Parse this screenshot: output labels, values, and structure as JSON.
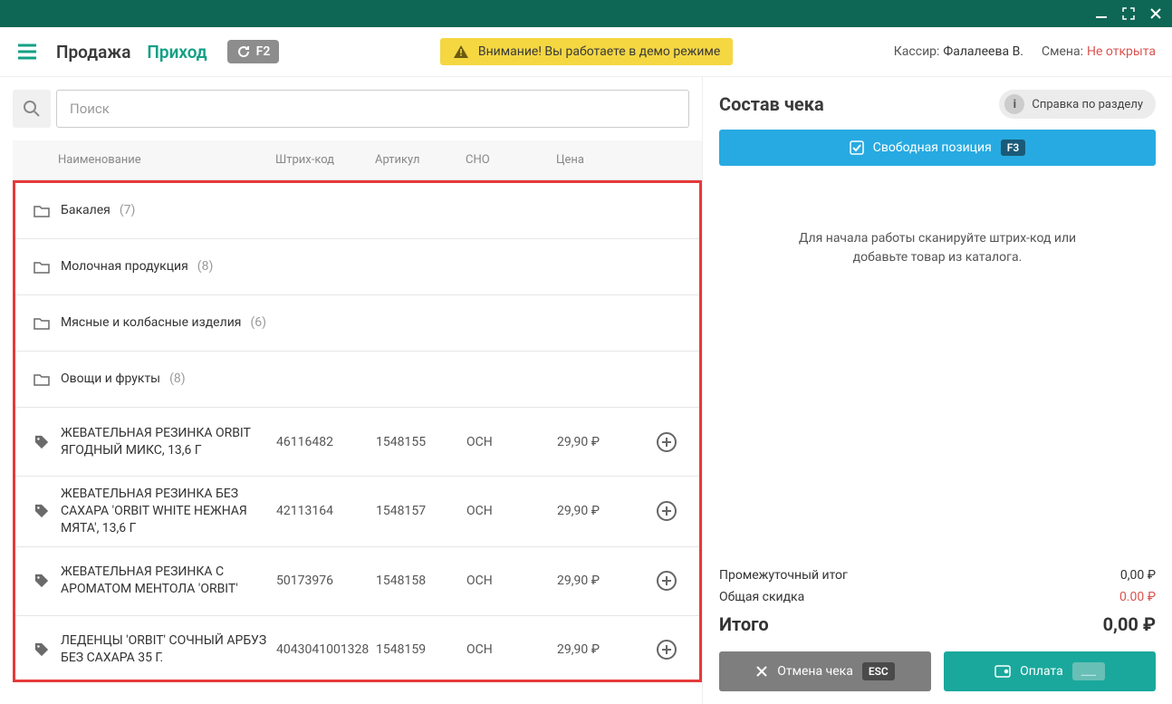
{
  "titlebar": {},
  "topbar": {
    "tab_sale": "Продажа",
    "tab_income": "Приход",
    "f2_key": "F2",
    "warning": "Внимание! Вы работаете в демо режиме",
    "cashier_label": "Кассир:",
    "cashier_name": "Фалалеева В.",
    "shift_label": "Смена:",
    "shift_value": "Не открыта"
  },
  "search": {
    "placeholder": "Поиск"
  },
  "columns": {
    "name": "Наименование",
    "barcode": "Штрих-код",
    "article": "Артикул",
    "sno": "СНО",
    "price": "Цена"
  },
  "folders": [
    {
      "name": "Бакалея",
      "count": "(7)"
    },
    {
      "name": "Молочная продукция",
      "count": "(8)"
    },
    {
      "name": "Мясные и колбасные изделия",
      "count": "(6)"
    },
    {
      "name": "Овощи и фрукты",
      "count": "(8)"
    }
  ],
  "products": [
    {
      "name": "ЖЕВАТЕЛЬНАЯ РЕЗИНКА ORBIT ЯГОДНЫЙ МИКС, 13,6 Г",
      "barcode": "46116482",
      "article": "1548155",
      "sno": "ОСН",
      "price": "29,90 ₽"
    },
    {
      "name": "ЖЕВАТЕЛЬНАЯ РЕЗИНКА БЕЗ САХАРА 'ORBIT WHITE НЕЖНАЯ МЯТА', 13,6 Г",
      "barcode": "42113164",
      "article": "1548157",
      "sno": "ОСН",
      "price": "29,90 ₽"
    },
    {
      "name": "ЖЕВАТЕЛЬНАЯ РЕЗИНКА С АРОМАТОМ МЕНТОЛА 'ORBIT'",
      "barcode": "50173976",
      "article": "1548158",
      "sno": "ОСН",
      "price": "29,90 ₽"
    },
    {
      "name": "ЛЕДЕНЦЫ 'ORBIT' СОЧНЫЙ АРБУЗ БЕЗ САХАРА 35 Г.",
      "barcode": "4043041001328",
      "article": "1548159",
      "sno": "ОСН",
      "price": "29,90 ₽"
    }
  ],
  "receipt": {
    "title": "Состав чека",
    "help": "Справка по разделу",
    "freepos_label": "Свободная позиция",
    "freepos_key": "F3",
    "hint_line1": "Для начала работы сканируйте штрих-код или",
    "hint_line2": "добавьте товар из каталога.",
    "subtotal_label": "Промежуточный итог",
    "subtotal_value": "0,00 ₽",
    "discount_label": "Общая скидка",
    "discount_value": "0.00 ₽",
    "total_label": "Итого",
    "total_value": "0,00 ₽",
    "cancel_label": "Отмена чека",
    "cancel_key": "ESC",
    "pay_label": "Оплата",
    "pay_key": "___"
  }
}
